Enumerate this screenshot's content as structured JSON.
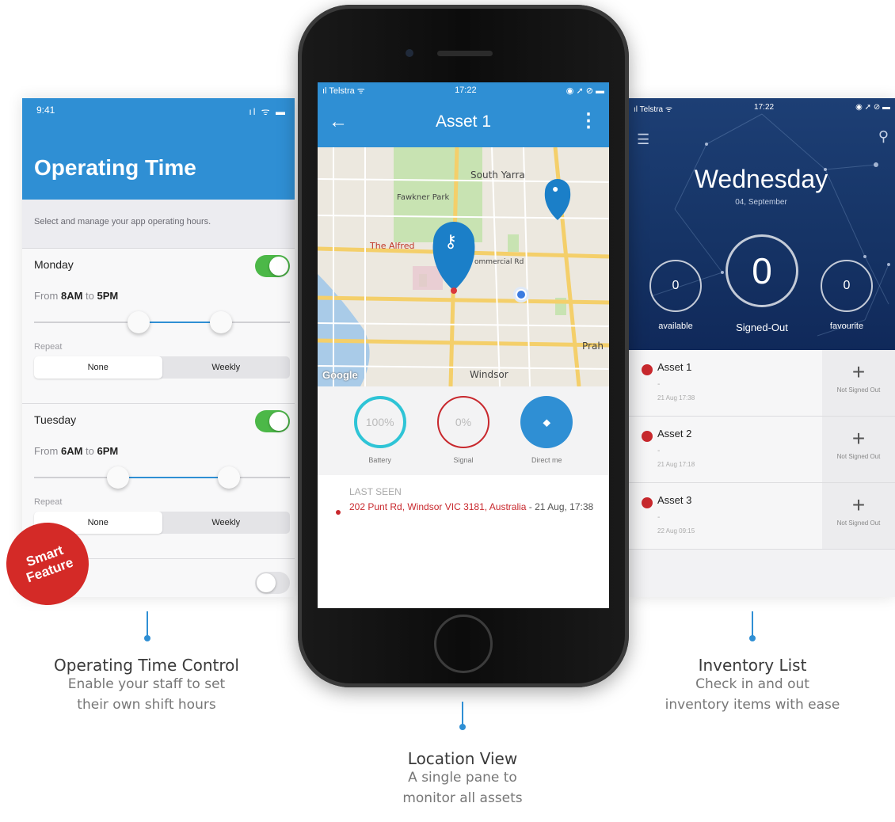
{
  "left": {
    "status_time": "9:41",
    "status_icons": "ıl ᯤ ▬",
    "title": "Operating Time",
    "subtitle": "Select and manage your app operating hours.",
    "days": [
      {
        "name": "Monday",
        "from_label": "From",
        "start": "8AM",
        "to_label": "to",
        "end": "5PM",
        "repeat_label": "Repeat",
        "options": [
          "None",
          "Weekly"
        ],
        "enabled": true
      },
      {
        "name": "Tuesday",
        "from_label": "From",
        "start": "6AM",
        "to_label": "to",
        "end": "6PM",
        "repeat_label": "Repeat",
        "options": [
          "None",
          "Weekly"
        ],
        "enabled": true
      }
    ],
    "badge_line1": "Smart",
    "badge_line2": "Feature"
  },
  "phone": {
    "carrier": "ıl Telstra ᯤ",
    "time": "17:22",
    "status_icons": "◉ ➚ ⊘ ▬",
    "back_icon": "←",
    "title": "Asset 1",
    "more_icon": "⋮",
    "map": {
      "labels": {
        "south_yarra": "South Yarra",
        "fawkner_park": "Fawkner Park",
        "the_alfred": "The Alfred",
        "commercial_rd": "ommercial Rd",
        "prah": "Prah",
        "windsor": "Windsor",
        "google": "Google"
      }
    },
    "stats": [
      {
        "value": "100%",
        "label": "Battery"
      },
      {
        "value": "0%",
        "label": "Signal"
      },
      {
        "value": "⬥",
        "label": "Direct me"
      }
    ],
    "last_seen_title": "LAST SEEN",
    "last_seen_address": "202 Punt Rd, Windsor VIC 3181, Australia",
    "last_seen_time": " - 21 Aug, 17:38"
  },
  "right": {
    "carrier": "ıl Telstra ᯤ",
    "time": "17:22",
    "status_icons": "◉ ➚ ⊘ ▬",
    "menu_icon": "☰",
    "search_icon": "⚲",
    "day": "Wednesday",
    "date": "04, September",
    "counters": [
      {
        "value": "0",
        "label": "available"
      },
      {
        "value": "0",
        "label": "Signed-Out"
      },
      {
        "value": "0",
        "label": "favourite"
      }
    ],
    "assets": [
      {
        "name": "Asset 1",
        "dash": "-",
        "time": "21 Aug 17:38",
        "action": "+",
        "status": "Not Signed Out"
      },
      {
        "name": "Asset 2",
        "dash": "-",
        "time": "21 Aug 17:18",
        "action": "+",
        "status": "Not Signed Out"
      },
      {
        "name": "Asset 3",
        "dash": "-",
        "time": "22 Aug 09:15",
        "action": "+",
        "status": "Not Signed Out"
      }
    ]
  },
  "captions": {
    "left": {
      "title": "Operating Time Control",
      "line1": "Enable your staff to set",
      "line2": "their own shift hours"
    },
    "center": {
      "title": "Location View",
      "line1": "A single pane to",
      "line2": "monitor all assets"
    },
    "right": {
      "title": "Inventory List",
      "line1": "Check in and out",
      "line2": "inventory items with ease"
    }
  },
  "colors": {
    "accent": "#2f8fd4",
    "alert": "#c8282d",
    "toggle_on": "#4cb848",
    "battery": "#2ec4d6",
    "header_dark": "#163466"
  }
}
